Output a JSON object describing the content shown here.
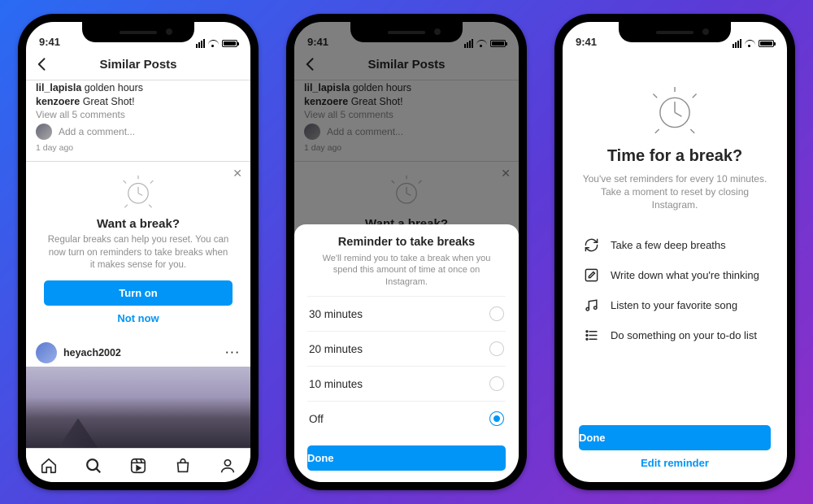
{
  "status": {
    "time": "9:41"
  },
  "header": {
    "title": "Similar Posts"
  },
  "comments": {
    "c1_user": "lil_lapisla",
    "c1_text": "golden hours",
    "c2_user": "kenzoere",
    "c2_text": "Great Shot!",
    "view_all": "View all 5 comments",
    "add_placeholder": "Add a comment...",
    "ago": "1 day ago"
  },
  "prompt": {
    "title": "Want a break?",
    "body": "Regular breaks can help you reset. You can now turn on reminders to take breaks when it makes sense for you.",
    "turn_on": "Turn on",
    "not_now": "Not now"
  },
  "next_post": {
    "username": "heyach2002"
  },
  "sheet": {
    "title": "Reminder to take breaks",
    "sub": "We'll remind you to take a break when you spend this amount of time at once on Instagram.",
    "opt30": "30 minutes",
    "opt20": "20 minutes",
    "opt10": "10 minutes",
    "off": "Off",
    "done": "Done"
  },
  "break": {
    "title": "Time for a break?",
    "sub": "You've set reminders for every 10 minutes. Take a moment to reset by closing Instagram.",
    "tip1": "Take a few deep breaths",
    "tip2": "Write down what you're thinking",
    "tip3": "Listen to your favorite song",
    "tip4": "Do something on your to-do list",
    "done": "Done",
    "edit": "Edit reminder"
  }
}
